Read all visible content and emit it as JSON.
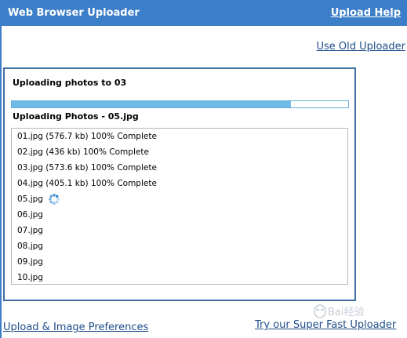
{
  "header": {
    "title": "Web Browser Uploader",
    "help_link": "Upload Help"
  },
  "links": {
    "old_uploader": "Use Old Uploader",
    "preferences": "Upload & Image Preferences",
    "super_fast": "Try our Super Fast Uploader"
  },
  "upload": {
    "title": "Uploading photos to 03",
    "progress_fraction": 0.83,
    "progress_label": "Uploading Photos - 05.jpg"
  },
  "files": [
    {
      "text": "01.jpg (576.7 kb) 100% Complete",
      "uploading": false
    },
    {
      "text": "02.jpg (436 kb) 100% Complete",
      "uploading": false
    },
    {
      "text": "03.jpg (573.6 kb) 100% Complete",
      "uploading": false
    },
    {
      "text": "04.jpg (405.1 kb) 100% Complete",
      "uploading": false
    },
    {
      "text": "05.jpg",
      "uploading": true
    },
    {
      "text": "06.jpg",
      "uploading": false
    },
    {
      "text": "07.jpg",
      "uploading": false
    },
    {
      "text": "08.jpg",
      "uploading": false
    },
    {
      "text": "09.jpg",
      "uploading": false
    },
    {
      "text": "10.jpg",
      "uploading": false
    }
  ],
  "icons": {
    "spinner": "loading-spinner-icon",
    "watermark": "baidu-logo"
  },
  "watermark_text": "Bai经验",
  "colors": {
    "header_bg": "#3c7ec8",
    "panel_border": "#3f6fa0",
    "progress_fill": "#6fbbe8",
    "link": "#1f4d8a"
  }
}
